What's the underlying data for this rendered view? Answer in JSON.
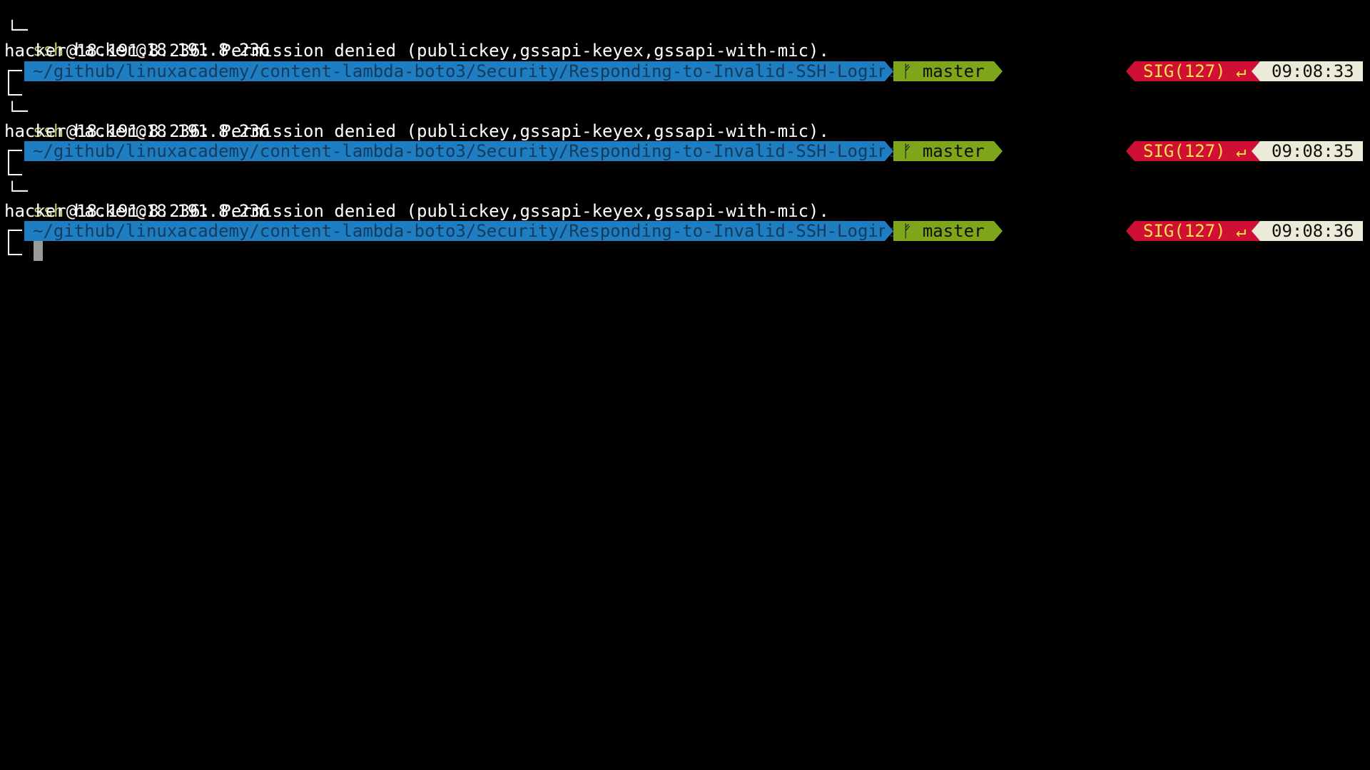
{
  "terminal": {
    "lines": [
      {
        "type": "cmd",
        "bracket": "└─",
        "cmd": "ssh",
        "args": "hacker@18.191.8.236"
      },
      {
        "type": "output",
        "text": "hacker@18.191.8.236: Permission denied (publickey,gssapi-keyex,gssapi-with-mic)."
      },
      {
        "type": "prompt",
        "path": "~/github/linuxacademy/content-lambda-boto3/Security/Responding-to-Invalid-SSH-Logins",
        "branch_icon": "ᚠ",
        "branch": "master",
        "status": "SIG(127) ↵",
        "time": "09:08:33"
      },
      {
        "type": "cmd",
        "bracket": "└─",
        "cmd": "ssh",
        "args": "hacker@18.191.8.236"
      },
      {
        "type": "output",
        "text": "hacker@18.191.8.236: Permission denied (publickey,gssapi-keyex,gssapi-with-mic)."
      },
      {
        "type": "prompt",
        "path": "~/github/linuxacademy/content-lambda-boto3/Security/Responding-to-Invalid-SSH-Logins",
        "branch_icon": "ᚠ",
        "branch": "master",
        "status": "SIG(127) ↵",
        "time": "09:08:35"
      },
      {
        "type": "cmd",
        "bracket": "└─",
        "cmd": "ssh",
        "args": "hacker@18.191.8.236"
      },
      {
        "type": "output",
        "text": "hacker@18.191.8.236: Permission denied (publickey,gssapi-keyex,gssapi-with-mic)."
      },
      {
        "type": "prompt",
        "path": "~/github/linuxacademy/content-lambda-boto3/Security/Responding-to-Invalid-SSH-Logins",
        "branch_icon": "ᚠ",
        "branch": "master",
        "status": "SIG(127) ↵",
        "time": "09:08:36"
      }
    ]
  },
  "colors": {
    "path_bg": "#1f7ec1",
    "branch_bg": "#7fa51a",
    "status_bg": "#d10f35",
    "status_fg": "#f5e64c",
    "time_bg": "#ecebd9"
  }
}
